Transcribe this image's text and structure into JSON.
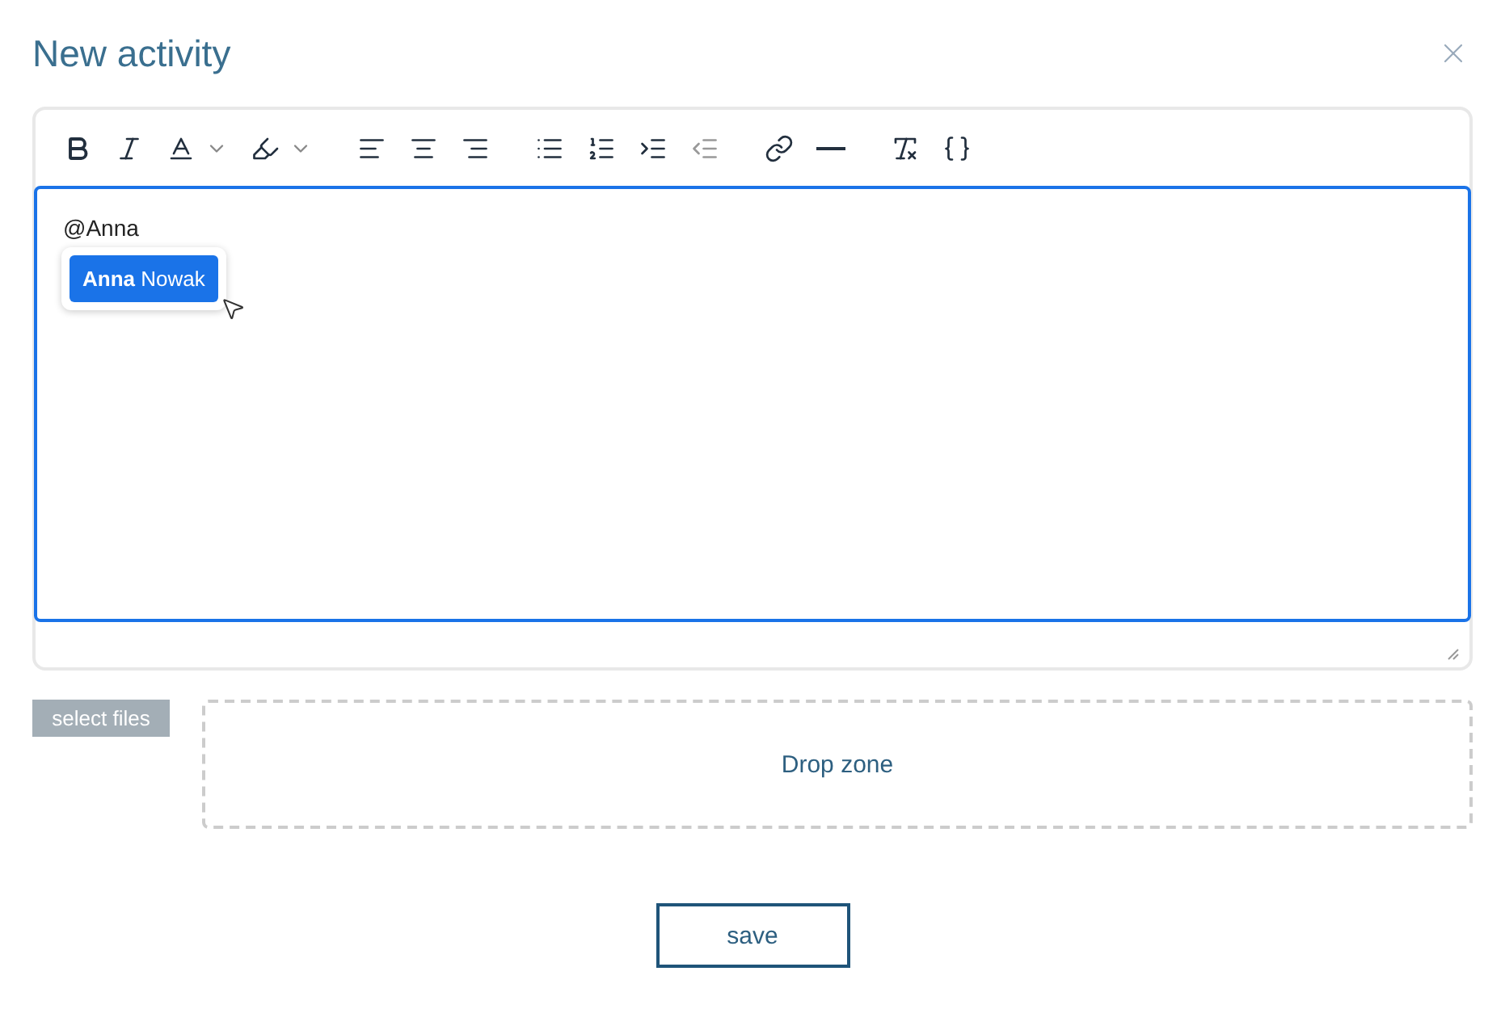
{
  "dialog": {
    "title": "New activity"
  },
  "toolbar": {
    "groups": [
      [
        {
          "kind": "bold",
          "disabled": false
        },
        {
          "kind": "italic",
          "disabled": false
        },
        {
          "kind": "text-color",
          "disabled": false,
          "dropdown": true
        },
        {
          "kind": "highlight",
          "disabled": false,
          "dropdown": true
        }
      ],
      [
        {
          "kind": "align-left",
          "disabled": false
        },
        {
          "kind": "align-center",
          "disabled": false
        },
        {
          "kind": "align-right",
          "disabled": false
        }
      ],
      [
        {
          "kind": "bullet-list",
          "disabled": false
        },
        {
          "kind": "numbered-list",
          "disabled": false
        },
        {
          "kind": "indent",
          "disabled": false
        },
        {
          "kind": "outdent",
          "disabled": true
        }
      ],
      [
        {
          "kind": "link",
          "disabled": false
        },
        {
          "kind": "rule",
          "disabled": false
        }
      ],
      [
        {
          "kind": "clear-format",
          "disabled": false
        },
        {
          "kind": "source",
          "disabled": false
        }
      ]
    ]
  },
  "editor": {
    "content": "@Anna",
    "suggestions": [
      {
        "label": "**Anna** Nowak",
        "selected": true
      }
    ]
  },
  "attachments": {
    "button": "select files",
    "drop_zone": "Drop zone"
  },
  "save_button": "save"
}
